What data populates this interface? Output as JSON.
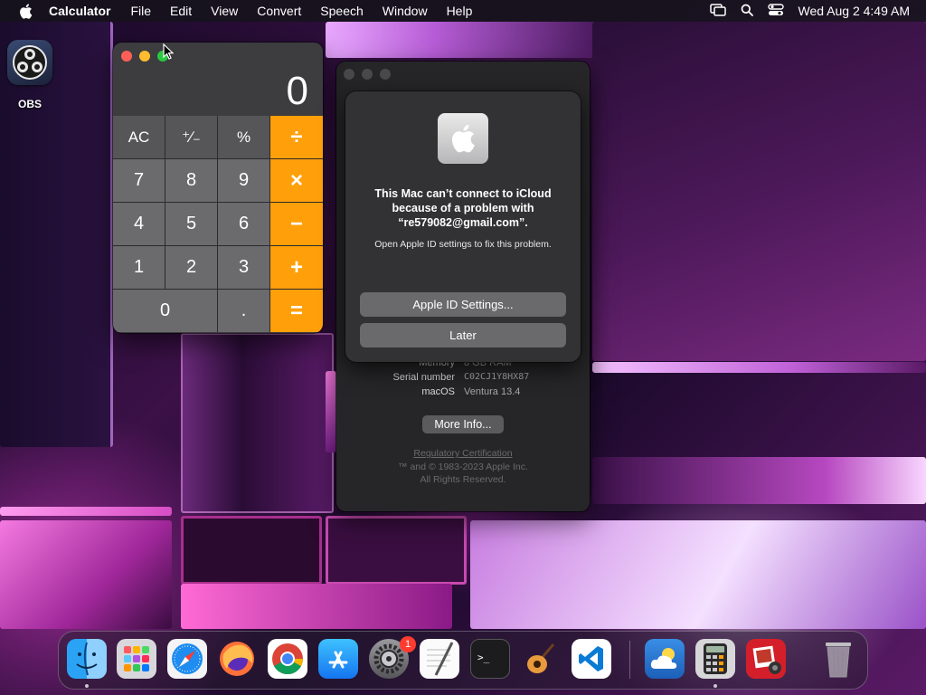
{
  "menubar": {
    "app_name": "Calculator",
    "menus": [
      "File",
      "Edit",
      "View",
      "Convert",
      "Speech",
      "Window",
      "Help"
    ],
    "clock": "Wed Aug 2  4:49 AM"
  },
  "desktop": {
    "icons": [
      {
        "label": "OBS",
        "icon": "obs-icon"
      }
    ]
  },
  "calculator": {
    "display": "0",
    "keys": [
      "AC",
      "⁺∕₋",
      "%",
      "÷",
      "7",
      "8",
      "9",
      "×",
      "4",
      "5",
      "6",
      "−",
      "1",
      "2",
      "3",
      "+",
      "0",
      ".",
      "="
    ]
  },
  "about_window": {
    "rows": [
      {
        "key": "Memory",
        "value": "8 GB RAM"
      },
      {
        "key": "Serial number",
        "value": "C02CJ1Y8HX87"
      },
      {
        "key": "macOS",
        "value": "Ventura 13.4"
      }
    ],
    "more_info_label": "More Info...",
    "regulatory_link": "Regulatory Certification",
    "copyright": "™ and © 1983-2023 Apple Inc.",
    "rights": "All Rights Reserved."
  },
  "alert": {
    "title": "This Mac can’t connect to iCloud because of a problem with “re579082@gmail.com”.",
    "message": "Open Apple ID settings to fix this problem.",
    "primary_button": "Apple ID Settings...",
    "secondary_button": "Later"
  },
  "dock": {
    "apps": [
      {
        "name": "Finder",
        "icon": "finder-icon",
        "running": true
      },
      {
        "name": "Launchpad",
        "icon": "launchpad-icon",
        "running": false
      },
      {
        "name": "Safari",
        "icon": "safari-icon",
        "running": false
      },
      {
        "name": "Firefox",
        "icon": "firefox-icon",
        "running": false
      },
      {
        "name": "Chrome",
        "icon": "chrome-icon",
        "running": false
      },
      {
        "name": "App Store",
        "icon": "app-store-icon",
        "running": false
      },
      {
        "name": "System Settings",
        "icon": "settings-gear-icon",
        "running": false,
        "badge": "1"
      },
      {
        "name": "TextEdit",
        "icon": "textedit-icon",
        "running": false
      },
      {
        "name": "Terminal",
        "icon": "terminal-icon",
        "running": false
      },
      {
        "name": "GarageBand",
        "icon": "guitar-icon",
        "running": false
      },
      {
        "name": "Visual Studio Code",
        "icon": "vscode-icon",
        "running": false
      },
      {
        "name": "Weather",
        "icon": "weather-icon",
        "running": false
      },
      {
        "name": "Calculator",
        "icon": "calculator-icon",
        "running": true
      },
      {
        "name": "Photo Booth",
        "icon": "photo-booth-icon",
        "running": false
      },
      {
        "name": "Trash",
        "icon": "trash-icon",
        "running": false
      }
    ]
  }
}
